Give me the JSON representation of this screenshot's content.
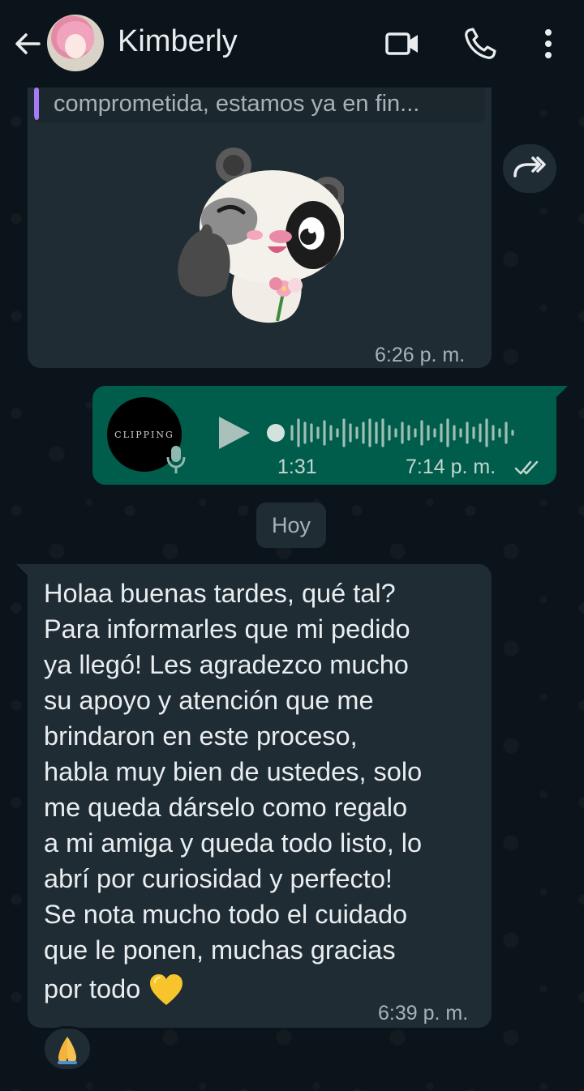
{
  "header": {
    "contact_name": "Kimberly",
    "icons": [
      "back-arrow-icon",
      "video-call-icon",
      "phone-icon",
      "more-vert-icon"
    ]
  },
  "messages": {
    "sticker_message": {
      "quoted_text": "comprometida, estamos ya en fin...",
      "time": "6:26 p. m."
    },
    "voice_message": {
      "avatar_label": "CLIPPING",
      "duration": "1:31",
      "time": "7:14 p. m."
    },
    "day_separator": "Hoy",
    "text_message": {
      "lines": [
        "Holaa buenas tardes, qué tal?",
        "Para informarles que mi pedido",
        "ya llegó! Les agradezco mucho",
        "su apoyo y atención que me",
        "brindaron en este proceso,",
        "habla muy bien de ustedes, solo",
        "me queda dárselo como regalo",
        "a mi amiga y queda todo listo, lo",
        "abrí por curiosidad y perfecto!",
        "Se nota mucho todo el cuidado",
        "que le ponen, muchas gracias",
        "por todo"
      ],
      "emoji": "yellow-heart",
      "time": "6:39 p. m.",
      "reaction": "folded-hands"
    }
  },
  "colors": {
    "background": "#0b141a",
    "incoming_bubble": "#1f2c34",
    "outgoing_bubble": "#005c4b",
    "quote_bar": "#a57bf5",
    "meta_text": "#a7b1b8",
    "read_ticks": "#c3d6cf"
  }
}
